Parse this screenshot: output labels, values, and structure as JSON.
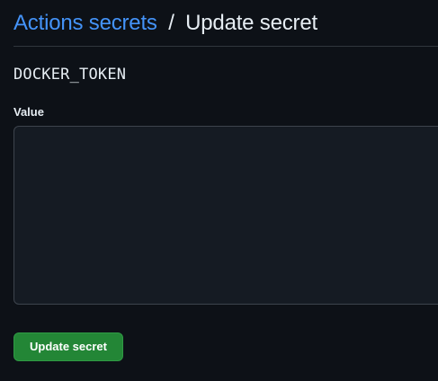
{
  "breadcrumb": {
    "parent_label": "Actions secrets",
    "separator": "/",
    "current_label": "Update secret"
  },
  "secret": {
    "name": "DOCKER_TOKEN"
  },
  "form": {
    "value_label": "Value",
    "value_text": "",
    "submit_label": "Update secret"
  },
  "colors": {
    "background": "#0d1117",
    "link": "#4493f8",
    "text": "#e6edf3",
    "input_background": "#151b23",
    "border": "#3d444d",
    "primary_button": "#238636"
  }
}
